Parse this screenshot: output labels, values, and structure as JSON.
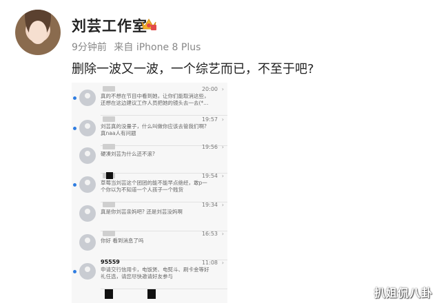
{
  "post": {
    "user_name": "刘芸工作室",
    "time_ago": "9分钟前",
    "source": "来自 iPhone 8 Plus",
    "text": "删除一波又一波，一个综艺而已，不至于吧?"
  },
  "icons": {
    "verified": "crown-icon",
    "avatar": "avatar-image"
  },
  "screenshot": {
    "messages": [
      {
        "sender": "",
        "time": "20:00",
        "preview": "真的不想在节目中看到她，让你们能取消这些，还想在这边建议工作人员把她的镜头去一去(*..."
      },
      {
        "sender": "",
        "time": "19:57",
        "preview": "刘芸真的没量子，什么叫做你应该去管我们啊? 真naa人有问题"
      },
      {
        "sender": "",
        "time": "19:56",
        "preview": "硬凑刘芸为什么还不滚?"
      },
      {
        "sender": "",
        "time": "19:54",
        "preview": "草莓当刘芸这个团团的能不能早点绝经，敢p一个你以为不知道一个人孩子一个贱货"
      },
      {
        "sender": "",
        "time": "19:34",
        "preview": "真是你刘芸亲妈吧? 还是刘芸没妈啊"
      },
      {
        "sender": "",
        "time": "16:53",
        "preview": "你好 看到消息了吗"
      },
      {
        "sender": "95559",
        "time": "11:08",
        "preview": "申请交行信用卡，电饭煲、电熨斗、刷卡金等好礼任选，请您尽快邀请好友参与"
      }
    ]
  },
  "watermark": "扒姐侃八卦"
}
